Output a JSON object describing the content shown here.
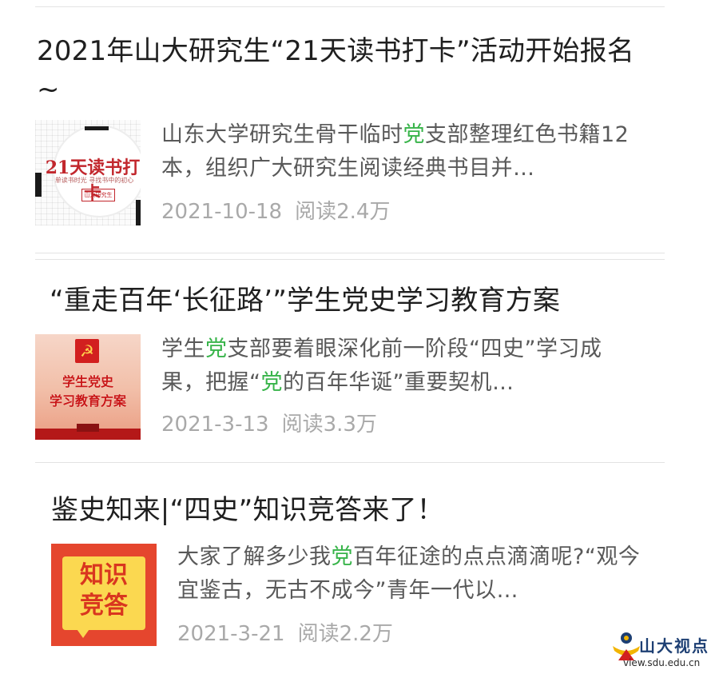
{
  "articles": [
    {
      "title": "2021年山大研究生“21天读书打卡”活动开始报名~",
      "summary_parts": [
        "山东大学研究生骨干临时",
        "党",
        "支部整理红色书籍12本，组织广大研究生阅读经典书目并…"
      ],
      "date": "2021-10-18",
      "views": "阅读2.4万",
      "thumb": {
        "big_text": "21天读书打卡",
        "small_text": "单读书时光 寻找书中的初心",
        "stamp_text": "山大研究生"
      }
    },
    {
      "title": "“重走百年‘长征路’”学生党史学习教育方案",
      "summary_parts": [
        "学生",
        "党",
        "支部要着眼深化前一阶段“四史”学习成果，把握“",
        "党",
        "的百年华诞”重要契机…"
      ],
      "date": "2021-3-13",
      "views": "阅读3.3万",
      "thumb": {
        "emblem": "☭",
        "line1": "学生党史",
        "line2": "学习教育方案"
      }
    },
    {
      "title": "鉴史知来|“四史”知识竞答来了！",
      "summary_parts": [
        "大家了解多少我",
        "党",
        "百年征途的点点滴滴呢?“观今宜鉴古，无古不成今”青年一代以…"
      ],
      "date": "2021-3-21",
      "views": "阅读2.2万",
      "thumb": {
        "line1": "知识",
        "line2": "竞答"
      }
    }
  ],
  "watermark": {
    "name": "山大视点",
    "url": "view.sdu.edu.cn"
  },
  "colors": {
    "highlight": "#38b44a",
    "title": "#1f1f1f",
    "summary": "#595959",
    "meta": "#a9a9a9",
    "divider": "#e3e3e3"
  }
}
